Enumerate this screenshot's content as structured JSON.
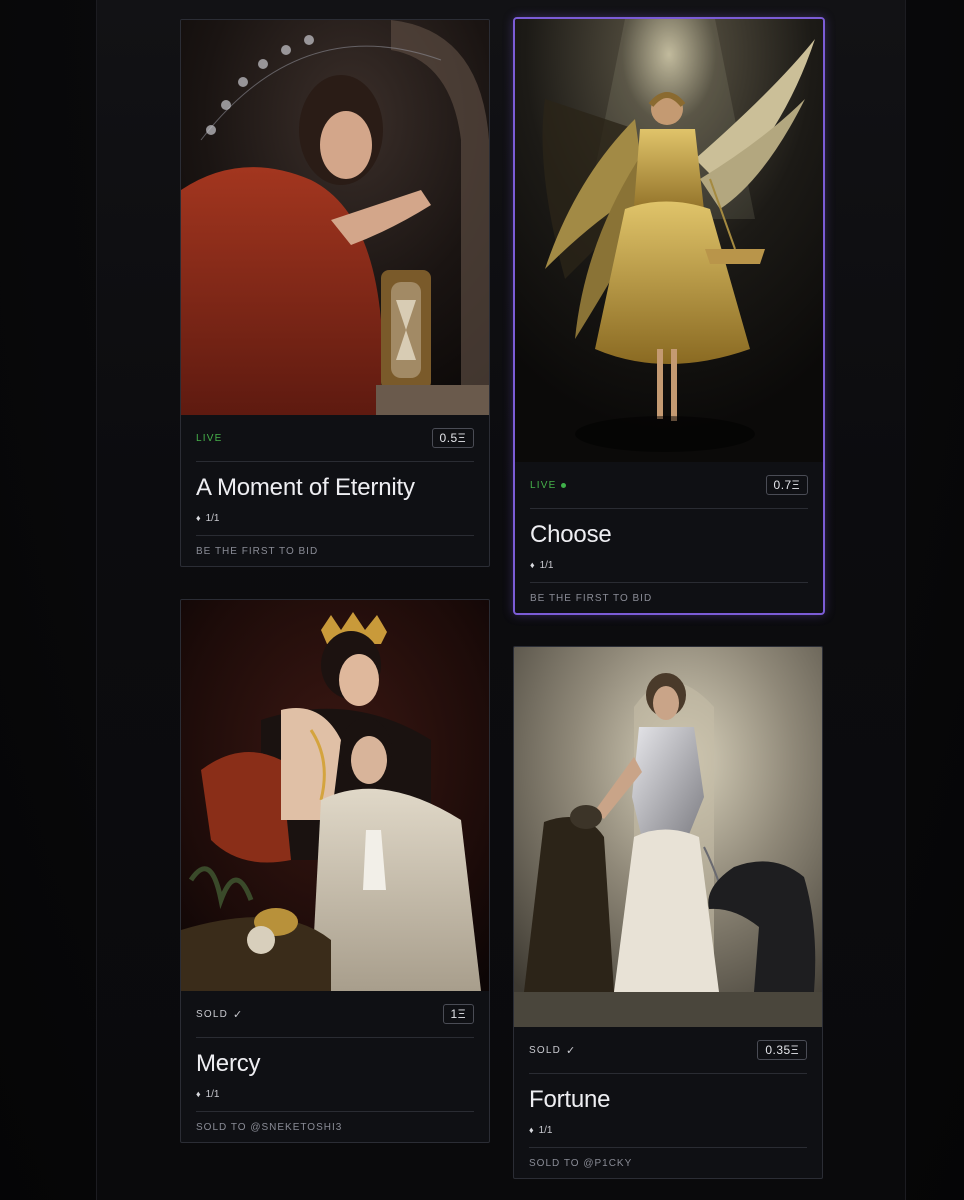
{
  "cards": [
    {
      "status": "LIVE",
      "price": "0.5Ξ",
      "title": "A Moment of Eternity",
      "edition": "1/1",
      "footer": "BE THE FIRST TO BID",
      "artwork_icon": "woman-with-hourglass-painting"
    },
    {
      "status": "LIVE",
      "price": "0.7Ξ",
      "title": "Choose",
      "edition": "1/1",
      "footer": "BE THE FIRST TO BID",
      "artwork_icon": "golden-angel-with-scales-painting"
    },
    {
      "status": "SOLD",
      "price": "1Ξ",
      "title": "Mercy",
      "edition": "1/1",
      "footer": "SOLD TO @SNEKETOSHI3",
      "artwork_icon": "crowned-queen-embracing-woman-painting"
    },
    {
      "status": "SOLD",
      "price": "0.35Ξ",
      "title": "Fortune",
      "edition": "1/1",
      "footer": "SOLD TO @P1CKY",
      "artwork_icon": "silver-woman-with-hounds-painting"
    }
  ],
  "icons": {
    "eth": "ethereum-icon",
    "check": "check-icon",
    "live_dot": "live-dot-icon"
  },
  "colors": {
    "accent_selected": "#7b5cd6",
    "live": "#46b04a",
    "card_bg": "#0f1014"
  }
}
